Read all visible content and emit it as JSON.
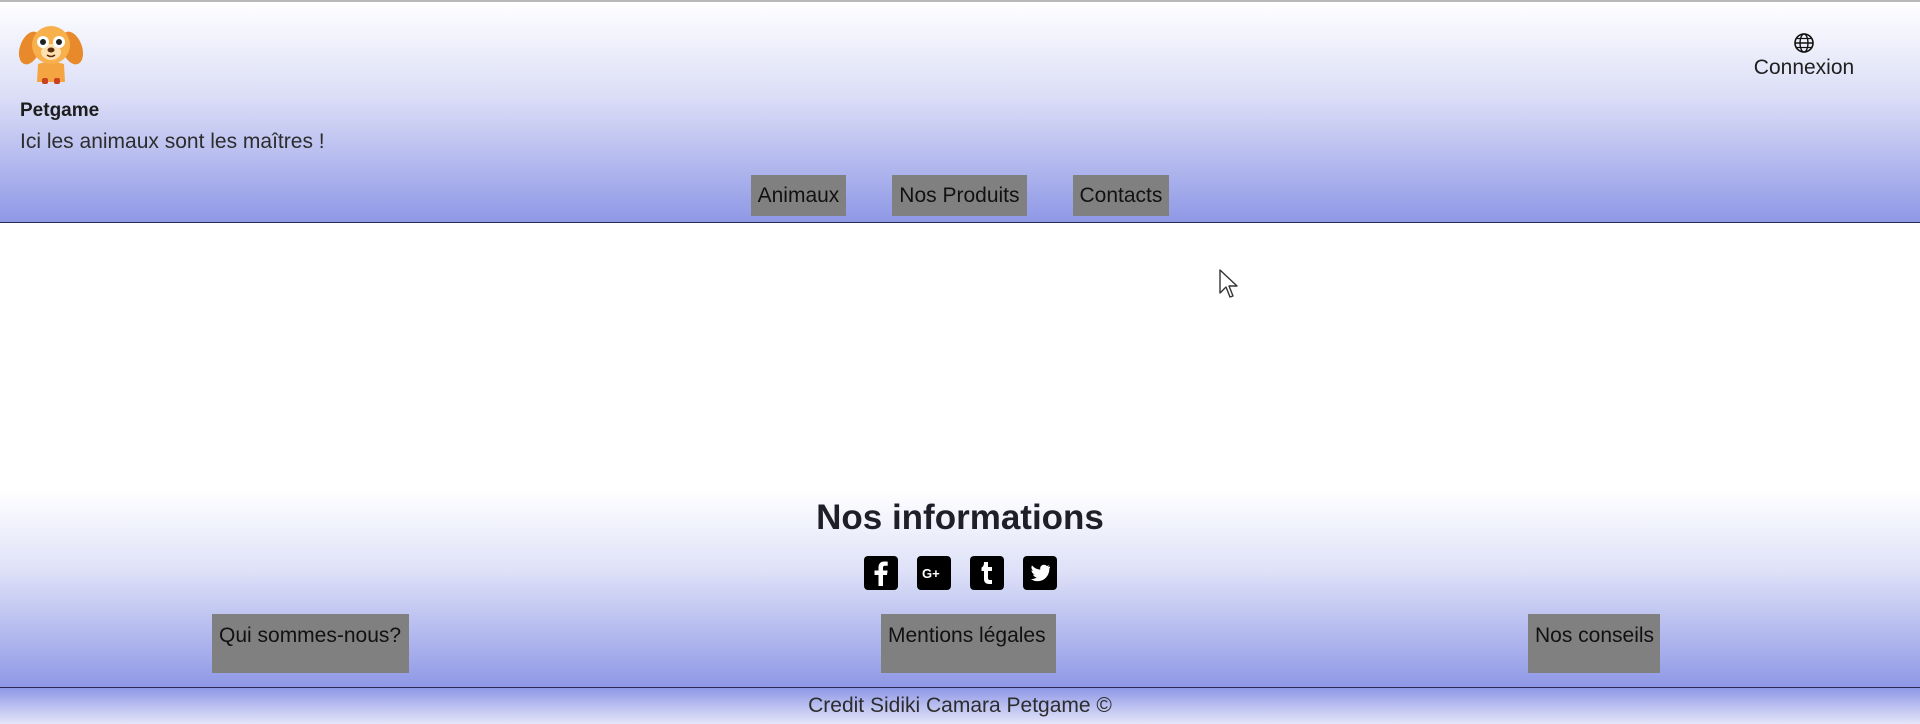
{
  "header": {
    "brand": "Petgame",
    "tagline": "Ici les animaux sont les maîtres !",
    "login_label": "Connexion",
    "logo_icon": "dog-icon",
    "login_icon": "globe-icon"
  },
  "nav": {
    "items": [
      {
        "label": "Animaux"
      },
      {
        "label": "Nos Produits"
      },
      {
        "label": "Contacts"
      }
    ]
  },
  "footer": {
    "title": "Nos informations",
    "socials": [
      {
        "icon": "facebook-icon"
      },
      {
        "icon": "google-plus-icon"
      },
      {
        "icon": "tumblr-icon"
      },
      {
        "icon": "twitter-icon"
      }
    ],
    "links": [
      {
        "label": "Qui sommes-nous?"
      },
      {
        "label": "Mentions légales"
      },
      {
        "label": "Nos conseils"
      }
    ],
    "credit": "Credit Sidiki Camara Petgame ©"
  },
  "colors": {
    "gradient_top": "#ffffff",
    "gradient_bottom": "#8f98e6",
    "button_bg": "#808080"
  }
}
